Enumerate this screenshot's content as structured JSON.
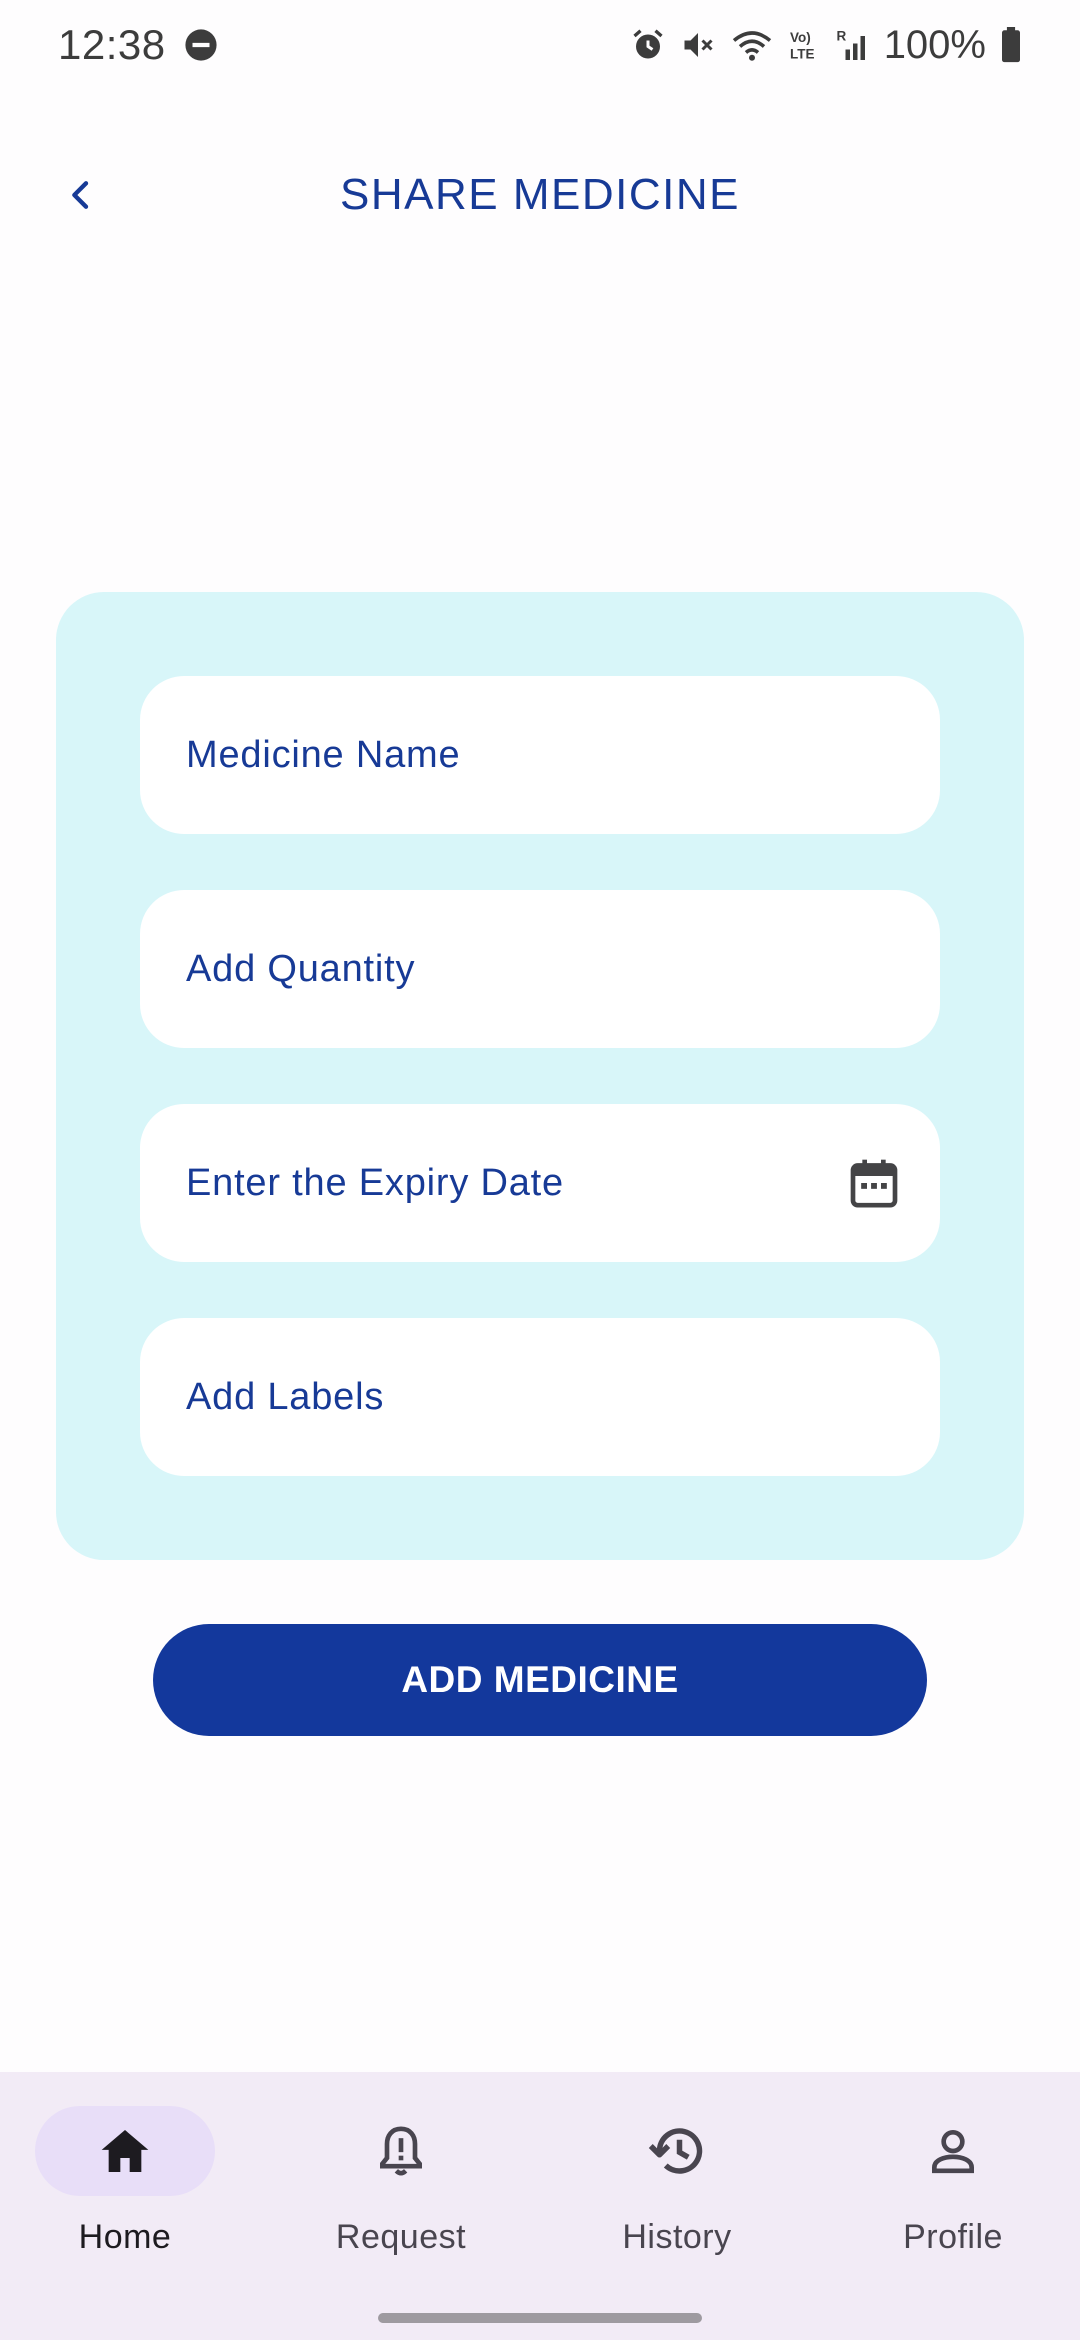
{
  "status_bar": {
    "time": "12:38",
    "battery": "100%",
    "icons": [
      "dnd-icon",
      "alarm-icon",
      "mute-icon",
      "wifi-icon",
      "volte-icon",
      "signal-icon",
      "battery-icon"
    ]
  },
  "header": {
    "back_icon": "chevron-left-icon",
    "title": "SHARE MEDICINE"
  },
  "form": {
    "medicine_name": {
      "value": "",
      "placeholder": "Medicine Name"
    },
    "quantity": {
      "value": "",
      "placeholder": "Add Quantity"
    },
    "expiry_date": {
      "value": "",
      "placeholder": "Enter the Expiry Date",
      "icon": "calendar-icon"
    },
    "labels": {
      "value": "",
      "placeholder": "Add Labels"
    }
  },
  "actions": {
    "add_medicine_label": "ADD MEDICINE"
  },
  "bottom_nav": {
    "items": [
      {
        "label": "Home",
        "icon": "home-icon",
        "active": true
      },
      {
        "label": "Request",
        "icon": "bell-alert-icon",
        "active": false
      },
      {
        "label": "History",
        "icon": "history-icon",
        "active": false
      },
      {
        "label": "Profile",
        "icon": "person-icon",
        "active": false
      }
    ]
  },
  "colors": {
    "primary": "#13389c",
    "title_text": "#173a96",
    "card_background": "#d8f6f9",
    "nav_background": "#f2ebf6",
    "nav_active_pill": "#e8def8"
  }
}
